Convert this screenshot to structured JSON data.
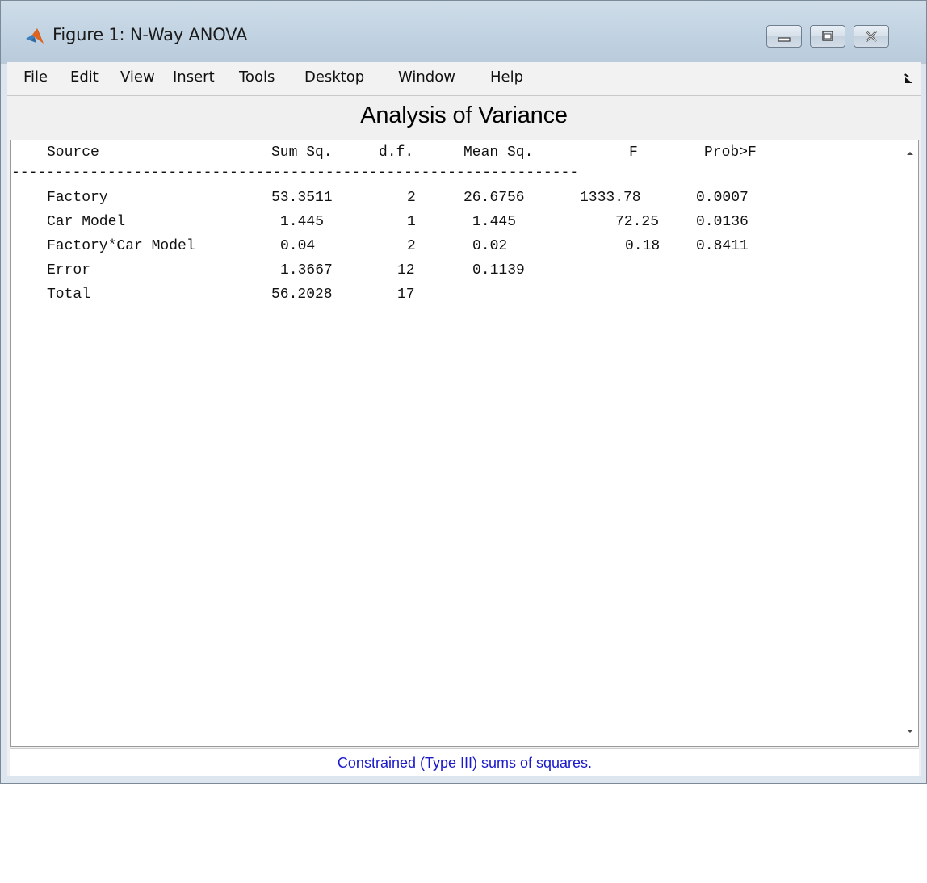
{
  "window": {
    "title": "Figure 1: N-Way ANOVA"
  },
  "menu": [
    "File",
    "Edit",
    "View",
    "Insert",
    "Tools",
    "Desktop",
    "Window",
    "Help"
  ],
  "heading": "Analysis of Variance",
  "table": {
    "columns": [
      "Source",
      "Sum Sq.",
      "d.f.",
      "Mean Sq.",
      "F",
      "Prob>F"
    ],
    "separator": "-----------------------------------------------------------------",
    "rows": [
      [
        "Factory",
        "53.3511",
        "2",
        "26.6756",
        "1333.78",
        "0.0007"
      ],
      [
        "Car Model",
        "1.445",
        "1",
        "1.445",
        "72.25",
        "0.0136"
      ],
      [
        "Factory*Car Model",
        "0.04",
        "2",
        "0.02",
        "0.18",
        "0.8411"
      ],
      [
        "Error",
        "1.3667",
        "12",
        "0.1139",
        "",
        ""
      ],
      [
        "Total",
        "56.2028",
        "17",
        "",
        "",
        ""
      ]
    ]
  },
  "footer": "Constrained (Type III) sums of squares.",
  "icons": {
    "app": "matlab-icon",
    "minimize": "minimize-icon",
    "maximize": "maximize-icon",
    "close": "close-icon",
    "dock": "dock-arrow-icon",
    "scroll_up": "scroll-up-icon",
    "scroll_down": "scroll-down-icon"
  },
  "colors": {
    "footer_text": "#1a1acc",
    "title_bar": "#c2d3e2"
  }
}
